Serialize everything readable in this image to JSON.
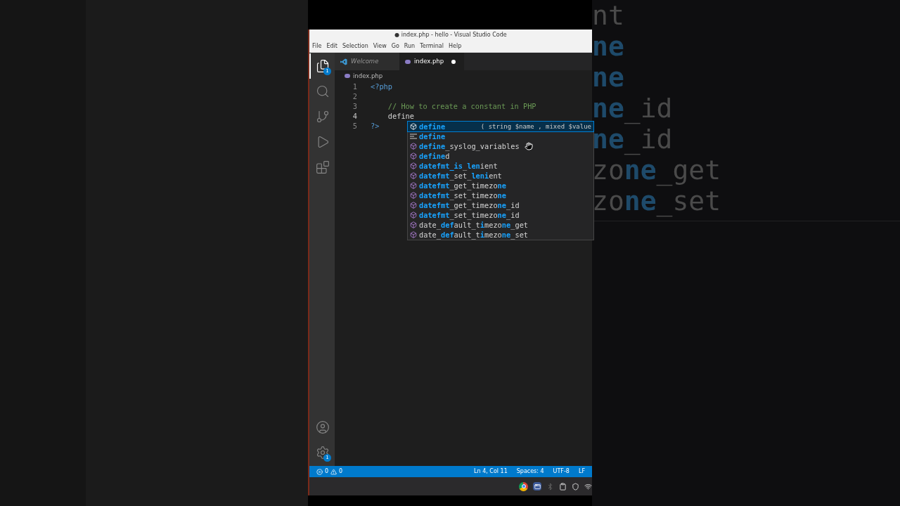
{
  "window": {
    "title": "● index.php - hello - Visual Studio Code"
  },
  "menu": [
    "File",
    "Edit",
    "Selection",
    "View",
    "Go",
    "Run",
    "Terminal",
    "Help"
  ],
  "activity_bar": {
    "top": [
      {
        "kind": "files",
        "selected": true,
        "badge": "1"
      },
      {
        "kind": "search",
        "selected": false
      },
      {
        "kind": "source-control",
        "selected": false
      },
      {
        "kind": "run",
        "selected": false
      },
      {
        "kind": "extensions",
        "selected": false
      }
    ],
    "bottom": [
      {
        "kind": "account",
        "selected": false
      },
      {
        "kind": "settings",
        "selected": false,
        "badge": "1"
      }
    ]
  },
  "tabs": [
    {
      "label": "Welcome",
      "kind": "welcome",
      "selected": false,
      "modified": false
    },
    {
      "label": "index.php",
      "kind": "php",
      "selected": true,
      "modified": true
    }
  ],
  "breadcrumb": "index.php",
  "code": [
    {
      "number": "1",
      "current": false,
      "indented": false,
      "tokens": [
        {
          "kind": "tag",
          "text": "<?php"
        }
      ]
    },
    {
      "number": "2",
      "current": false
    },
    {
      "number": "3",
      "current": false,
      "indented": true,
      "tokens": [
        {
          "kind": "comment",
          "text": "// How to create a constant in PHP"
        }
      ]
    },
    {
      "number": "4",
      "current": true,
      "indented": true,
      "tokens": [
        {
          "kind": "plain",
          "text": "define"
        }
      ]
    },
    {
      "number": "5",
      "current": false,
      "indented": false,
      "tokens": [
        {
          "kind": "tag",
          "text": "?>"
        }
      ]
    }
  ],
  "suggestions": [
    {
      "kind": "function",
      "selected": true,
      "detail": "( string $name , mixed $value",
      "parts": [
        {
          "text": "define",
          "match": true
        }
      ]
    },
    {
      "kind": "snippet",
      "selected": false,
      "parts": [
        {
          "text": "define",
          "match": true
        }
      ]
    },
    {
      "kind": "function",
      "selected": false,
      "parts": [
        {
          "text": "define",
          "match": true
        },
        {
          "text": "_syslog_variables",
          "match": false
        }
      ]
    },
    {
      "kind": "function",
      "selected": false,
      "parts": [
        {
          "text": "define",
          "match": true
        },
        {
          "text": "d",
          "match": false
        }
      ]
    },
    {
      "kind": "function",
      "selected": false,
      "parts": [
        {
          "text": "datefmt_",
          "match": true
        },
        {
          "text": "is",
          "match": true
        },
        {
          "text": "_",
          "match": false
        },
        {
          "text": "len",
          "match": true
        },
        {
          "text": "ient",
          "match": false
        }
      ]
    },
    {
      "kind": "function",
      "selected": false,
      "parts": [
        {
          "text": "datefmt",
          "match": true
        },
        {
          "text": "_set_",
          "match": false
        },
        {
          "text": "leni",
          "match": true
        },
        {
          "text": "ent",
          "match": false
        }
      ]
    },
    {
      "kind": "function",
      "selected": false,
      "parts": [
        {
          "text": "datefmt",
          "match": true
        },
        {
          "text": "_get_timezo",
          "match": false
        },
        {
          "text": "ne",
          "match": true
        }
      ]
    },
    {
      "kind": "function",
      "selected": false,
      "parts": [
        {
          "text": "datefmt",
          "match": true
        },
        {
          "text": "_set_timezo",
          "match": false
        },
        {
          "text": "ne",
          "match": true
        }
      ]
    },
    {
      "kind": "function",
      "selected": false,
      "parts": [
        {
          "text": "datefmt",
          "match": true
        },
        {
          "text": "_get_timezo",
          "match": false
        },
        {
          "text": "ne",
          "match": true
        },
        {
          "text": "_id",
          "match": false
        }
      ]
    },
    {
      "kind": "function",
      "selected": false,
      "parts": [
        {
          "text": "datefmt",
          "match": true
        },
        {
          "text": "_set_timezo",
          "match": false
        },
        {
          "text": "ne",
          "match": true
        },
        {
          "text": "_id",
          "match": false
        }
      ]
    },
    {
      "kind": "function",
      "selected": false,
      "parts": [
        {
          "text": "date_",
          "match": false
        },
        {
          "text": "def",
          "match": true
        },
        {
          "text": "ault_t",
          "match": false
        },
        {
          "text": "i",
          "match": true
        },
        {
          "text": "mezo",
          "match": false
        },
        {
          "text": "ne",
          "match": true
        },
        {
          "text": "_get",
          "match": false
        }
      ]
    },
    {
      "kind": "function",
      "selected": false,
      "parts": [
        {
          "text": "date_",
          "match": false
        },
        {
          "text": "def",
          "match": true
        },
        {
          "text": "ault_t",
          "match": false
        },
        {
          "text": "i",
          "match": true
        },
        {
          "text": "mezo",
          "match": false
        },
        {
          "text": "ne",
          "match": true
        },
        {
          "text": "_set",
          "match": false
        }
      ]
    }
  ],
  "status_bar": {
    "errors": "0",
    "warnings": "0",
    "items": [
      "Ln 4, Col 11",
      "Spaces: 4",
      "UTF-8",
      "LF"
    ]
  },
  "tray": [
    {
      "kind": "chrome"
    },
    {
      "kind": "window"
    },
    {
      "kind": "bluetooth"
    },
    {
      "kind": "clipboard"
    },
    {
      "kind": "shield"
    },
    {
      "kind": "wifi"
    }
  ],
  "backdrop": [
    {
      "parts": [
        {
          "text": "nt",
          "match": false
        }
      ]
    },
    {
      "parts": [
        {
          "text": "ne",
          "match": true
        }
      ]
    },
    {
      "parts": [
        {
          "text": "ne",
          "match": true
        }
      ]
    },
    {
      "parts": [
        {
          "text": "ne",
          "match": true
        },
        {
          "text": "_id",
          "match": false
        }
      ]
    },
    {
      "parts": [
        {
          "text": "ne",
          "match": true
        },
        {
          "text": "_id",
          "match": false
        }
      ]
    },
    {
      "parts": [
        {
          "text": "zo",
          "match": false
        },
        {
          "text": "ne",
          "match": true
        },
        {
          "text": "_get",
          "match": false
        }
      ]
    },
    {
      "parts": [
        {
          "text": "zo",
          "match": false
        },
        {
          "text": "ne",
          "match": true
        },
        {
          "text": "_set",
          "match": false
        }
      ]
    }
  ]
}
